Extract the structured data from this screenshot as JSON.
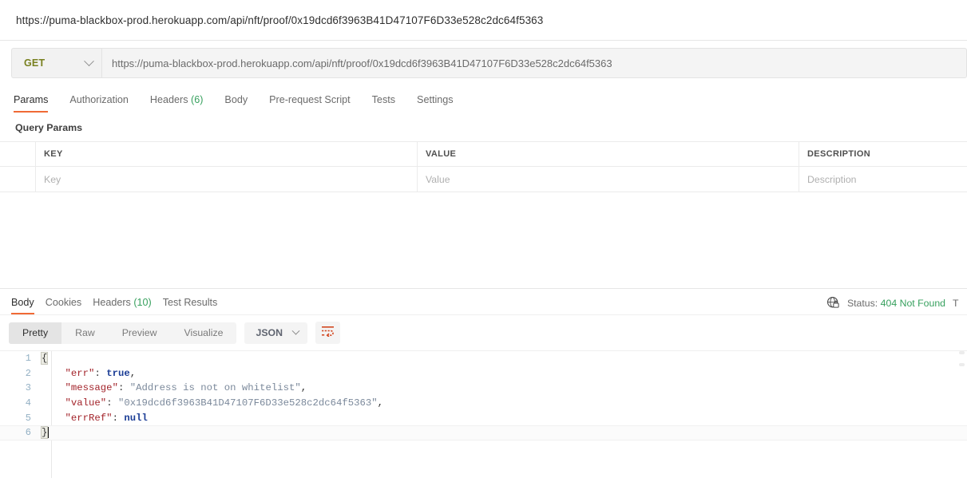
{
  "request": {
    "title": "https://puma-blackbox-prod.herokuapp.com/api/nft/proof/0x19dcd6f3963B41D47107F6D33e528c2dc64f5363",
    "method": "GET",
    "url": "https://puma-blackbox-prod.herokuapp.com/api/nft/proof/0x19dcd6f3963B41D47107F6D33e528c2dc64f5363",
    "tabs": [
      {
        "label": "Params",
        "count": "",
        "active": true
      },
      {
        "label": "Authorization",
        "count": "",
        "active": false
      },
      {
        "label": "Headers",
        "count": "(6)",
        "active": false
      },
      {
        "label": "Body",
        "count": "",
        "active": false
      },
      {
        "label": "Pre-request Script",
        "count": "",
        "active": false
      },
      {
        "label": "Tests",
        "count": "",
        "active": false
      },
      {
        "label": "Settings",
        "count": "",
        "active": false
      }
    ],
    "section_label": "Query Params",
    "table": {
      "headers": [
        "KEY",
        "VALUE",
        "DESCRIPTION"
      ],
      "rows": [
        {
          "key": "Key",
          "value": "Value",
          "description": "Description"
        }
      ]
    }
  },
  "response": {
    "tabs": [
      {
        "label": "Body",
        "count": "",
        "active": true
      },
      {
        "label": "Cookies",
        "count": "",
        "active": false
      },
      {
        "label": "Headers",
        "count": "(10)",
        "active": false
      },
      {
        "label": "Test Results",
        "count": "",
        "active": false
      }
    ],
    "status_label": "Status:",
    "status_code": "404 Not Found",
    "time_label": "T",
    "view_modes": [
      {
        "label": "Pretty",
        "active": true
      },
      {
        "label": "Raw",
        "active": false
      },
      {
        "label": "Preview",
        "active": false
      },
      {
        "label": "Visualize",
        "active": false
      }
    ],
    "format": "JSON",
    "wrap_icon": "wrap-text-icon",
    "body_lines": [
      {
        "n": "1",
        "tokens": [
          {
            "t": "{",
            "c": "brace"
          }
        ]
      },
      {
        "n": "2",
        "tokens": [
          {
            "t": "    ",
            "c": "pun"
          },
          {
            "t": "\"err\"",
            "c": "key"
          },
          {
            "t": ": ",
            "c": "pun"
          },
          {
            "t": "true",
            "c": "lit"
          },
          {
            "t": ",",
            "c": "pun"
          }
        ]
      },
      {
        "n": "3",
        "tokens": [
          {
            "t": "    ",
            "c": "pun"
          },
          {
            "t": "\"message\"",
            "c": "key"
          },
          {
            "t": ": ",
            "c": "pun"
          },
          {
            "t": "\"Address is not on whitelist\"",
            "c": "str"
          },
          {
            "t": ",",
            "c": "pun"
          }
        ]
      },
      {
        "n": "4",
        "tokens": [
          {
            "t": "    ",
            "c": "pun"
          },
          {
            "t": "\"value\"",
            "c": "key"
          },
          {
            "t": ": ",
            "c": "pun"
          },
          {
            "t": "\"0x19dcd6f3963B41D47107F6D33e528c2dc64f5363\"",
            "c": "str"
          },
          {
            "t": ",",
            "c": "pun"
          }
        ]
      },
      {
        "n": "5",
        "tokens": [
          {
            "t": "    ",
            "c": "pun"
          },
          {
            "t": "\"errRef\"",
            "c": "key"
          },
          {
            "t": ": ",
            "c": "pun"
          },
          {
            "t": "null",
            "c": "lit"
          }
        ]
      },
      {
        "n": "6",
        "tokens": [
          {
            "t": "}",
            "c": "brace"
          }
        ],
        "active": true,
        "caret": true
      }
    ]
  },
  "colors": {
    "accent": "#f06a35",
    "success": "#37a05e",
    "method": "#78801f",
    "key": "#a3242b",
    "string": "#7b899b",
    "literal": "#1b3d96",
    "linenum": "#93b0c4"
  }
}
